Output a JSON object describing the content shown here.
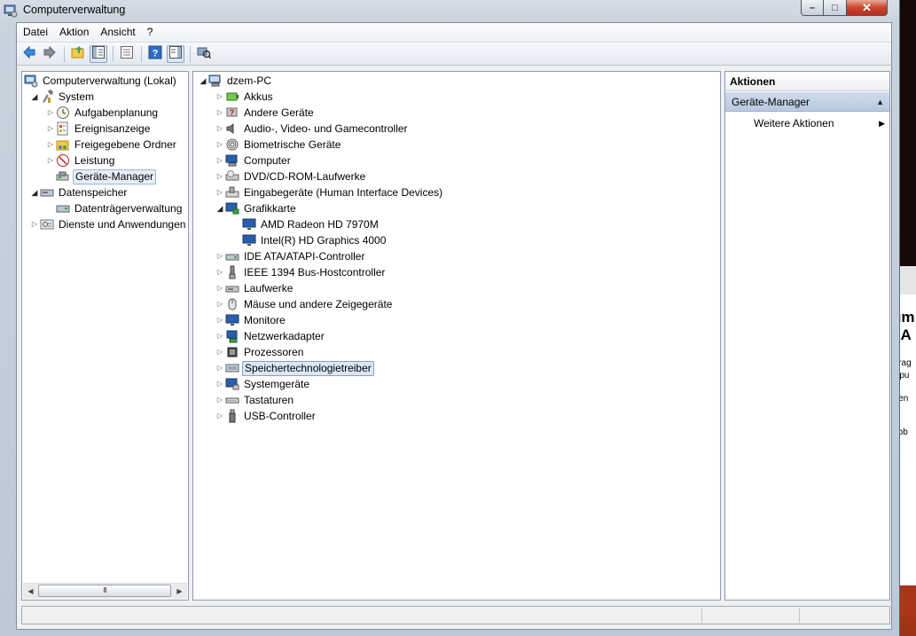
{
  "window": {
    "title": "Computerverwaltung",
    "controls": {
      "minimize": "–",
      "maximize": "□",
      "close": "✕"
    }
  },
  "menu": [
    "Datei",
    "Aktion",
    "Ansicht",
    "?"
  ],
  "toolbar": {
    "icons": [
      "back-arrow-icon",
      "forward-arrow-icon",
      "up-folder-icon",
      "show-hide-tree-icon",
      "properties-icon",
      "help-icon",
      "show-hide-action-pane-icon",
      "scan-hardware-icon"
    ]
  },
  "left_tree": {
    "root": "Computerverwaltung (Lokal)",
    "system": "System",
    "system_items": [
      "Aufgabenplanung",
      "Ereignisanzeige",
      "Freigegebene Ordner",
      "Leistung",
      "Geräte-Manager"
    ],
    "storage": "Datenspeicher",
    "storage_items": [
      "Datenträgerverwaltung"
    ],
    "services": "Dienste und Anwendungen",
    "scroll_grip": "III"
  },
  "device_tree": {
    "root": "dzem-PC",
    "categories": [
      "Akkus",
      "Andere Geräte",
      "Audio-, Video- und Gamecontroller",
      "Biometrische Geräte",
      "Computer",
      "DVD/CD-ROM-Laufwerke",
      "Eingabegeräte (Human Interface Devices)",
      "Grafikkarte",
      "IDE ATA/ATAPI-Controller",
      "IEEE 1394 Bus-Hostcontroller",
      "Laufwerke",
      "Mäuse und andere Zeigegeräte",
      "Monitore",
      "Netzwerkadapter",
      "Prozessoren",
      "Speichertechnologietreiber",
      "Systemgeräte",
      "Tastaturen",
      "USB-Controller"
    ],
    "graphics_children": [
      "AMD Radeon HD 7970M",
      "Intel(R) HD Graphics 4000"
    ]
  },
  "actions": {
    "header": "Aktionen",
    "section": "Geräte-Manager",
    "item": "Weitere Aktionen"
  },
  "background_window": {
    "frag1": "um",
    "frag2": "–A",
    "frag3": "Drag",
    "frag4": "mpu",
    "frag5": "wen",
    "frag6": "Abb"
  }
}
